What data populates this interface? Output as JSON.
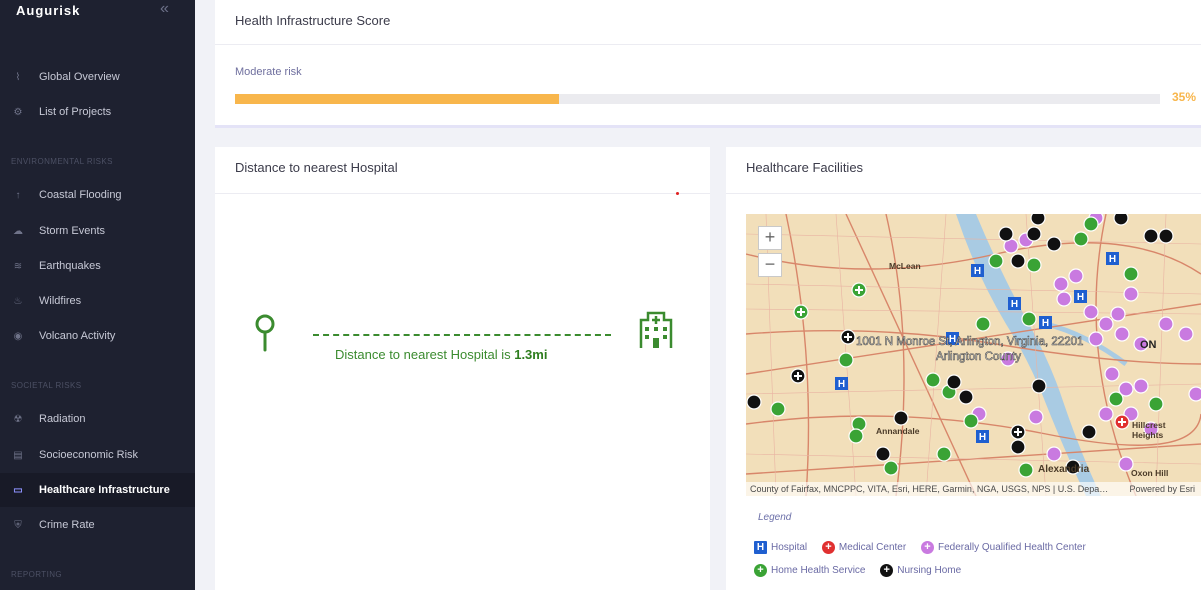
{
  "app": {
    "brand": "Augurisk",
    "collapse_glyph": "«"
  },
  "sidebar": {
    "items": [
      {
        "label": "Global Overview",
        "icon": "trend-icon",
        "glyph": "⌇"
      },
      {
        "label": "List of Projects",
        "icon": "gear-icon",
        "glyph": "⚙"
      },
      {
        "label": "Coastal Flooding",
        "icon": "arrow-up-icon",
        "glyph": "↑"
      },
      {
        "label": "Storm Events",
        "icon": "cloud-icon",
        "glyph": "☁"
      },
      {
        "label": "Earthquakes",
        "icon": "earthquake-icon",
        "glyph": "≋"
      },
      {
        "label": "Wildfires",
        "icon": "fire-icon",
        "glyph": "♨"
      },
      {
        "label": "Volcano Activity",
        "icon": "volcano-icon",
        "glyph": "◉"
      },
      {
        "label": "Radiation",
        "icon": "radiation-icon",
        "glyph": "☢"
      },
      {
        "label": "Socioeconomic Risk",
        "icon": "bank-icon",
        "glyph": "▤"
      },
      {
        "label": "Healthcare Infrastructure",
        "icon": "ambulance-icon",
        "glyph": "▭"
      },
      {
        "label": "Crime Rate",
        "icon": "shield-icon",
        "glyph": "⛨"
      }
    ],
    "sections": {
      "environmental": "ENVIRONMENTAL RISKS",
      "societal": "SOCIETAL RISKS",
      "reporting": "REPORTING"
    }
  },
  "score_card": {
    "title": "Health Infrastructure Score",
    "risk_label": "Moderate risk",
    "percent_text": "35%",
    "progress": 0.35,
    "bar_color": "#f8b64c"
  },
  "distance_card": {
    "title": "Distance to nearest Hospital",
    "text_prefix": "Distance to nearest Hospital is",
    "distance": "1.3mi",
    "accent_color": "#3b8b2f"
  },
  "facilities_card": {
    "title": "Healthcare Facilities",
    "map": {
      "zoom_in": "+",
      "zoom_out": "−",
      "address_label": "1001 N Monroe St, Arlington, Virginia, 22201",
      "county_label": "Arlington County",
      "place_labels": [
        "McLean",
        "Annandale",
        "Alexandria",
        "Hillcrest Heights",
        "Oxon Hill"
      ],
      "attribution": "County of Fairfax, MNCPPC, VITA, Esri, HERE, Garmin, NGA, USGS, NPS | U.S. Depa…",
      "powered_by": "Powered by Esri"
    },
    "legend_title": "Legend",
    "legend": [
      {
        "label": "Hospital",
        "icon": "hospital-icon",
        "color": "#1f5fd0"
      },
      {
        "label": "Medical Center",
        "icon": "medical-center-icon",
        "color": "#e03030"
      },
      {
        "label": "Federally Qualified Health Center",
        "icon": "fqhc-icon",
        "color": "#c97ae0"
      },
      {
        "label": "Home Health Service",
        "icon": "home-health-icon",
        "color": "#3aa335"
      },
      {
        "label": "Nursing Home",
        "icon": "nursing-home-icon",
        "color": "#111111"
      }
    ]
  }
}
